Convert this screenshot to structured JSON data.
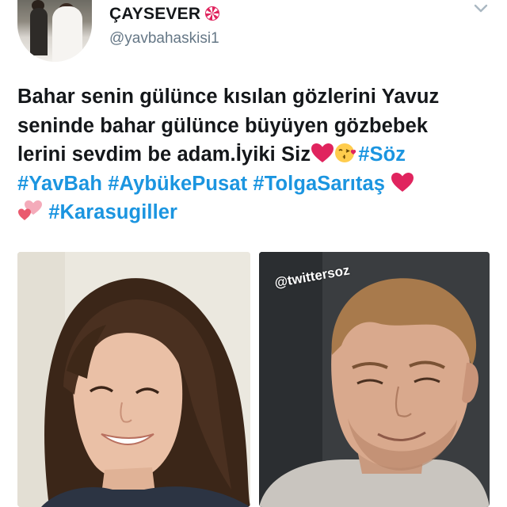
{
  "user": {
    "display_name": "ÇAYSEVER",
    "handle": "@yavbahaskisi1",
    "badge_icon": "candy-icon"
  },
  "menu_icon": "chevron-down-icon",
  "tweet": {
    "line1": "Bahar senin gülünce kısılan gözlerini Yavuz",
    "line2": "seninde bahar gülünce büyüyen gözbebek",
    "line3_text": "lerini sevdim be adam.İyiki Siz",
    "tag_soz": "#Söz",
    "tag_yavbah": "#YavBah",
    "tag_aybuke": "#AybükePusat",
    "tag_tolga": "#TolgaSarıtaş",
    "tag_karasu": "#Karasugiller",
    "emojis": [
      "red-heart-icon",
      "face-blowing-kiss-icon",
      "red-heart-icon",
      "two-hearts-icon"
    ]
  },
  "media": {
    "left_photo": "smiling-woman-photo",
    "right_photo": "smiling-man-photo",
    "watermark": "@twittersoz"
  },
  "colors": {
    "text": "#14171a",
    "secondary": "#657786",
    "hashtag": "#1b95e0",
    "heart": "#e0245e"
  }
}
